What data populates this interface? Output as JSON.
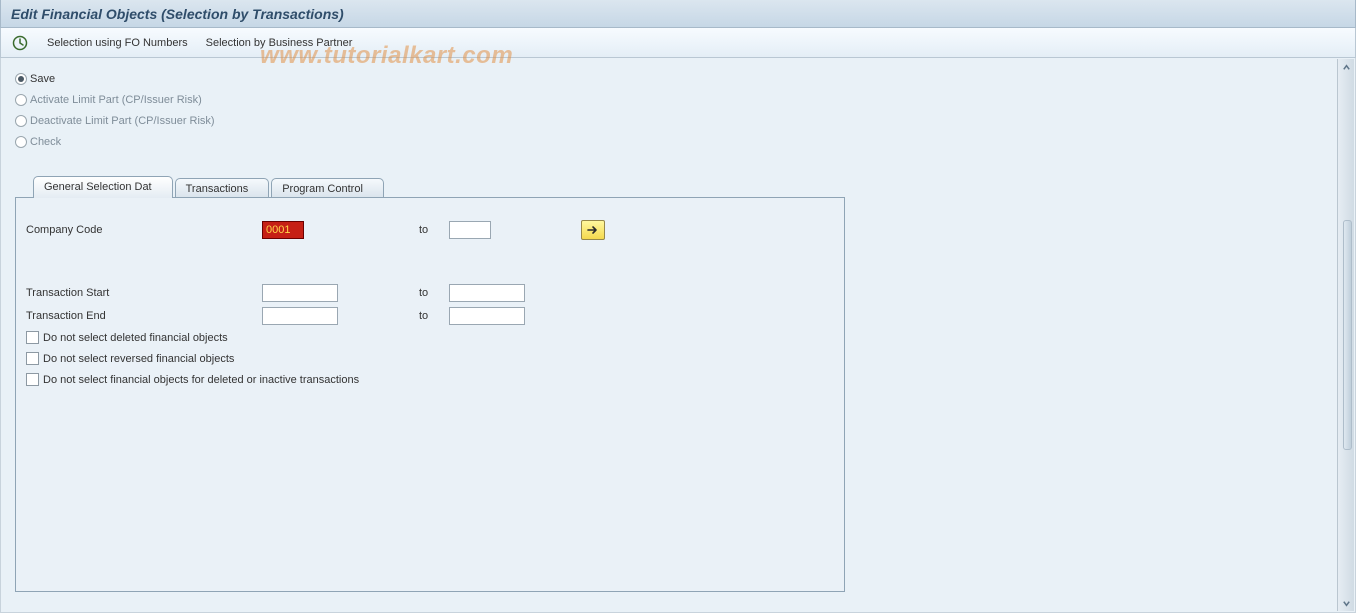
{
  "header": {
    "title": "Edit Financial Objects (Selection by Transactions)"
  },
  "toolbar": {
    "link1": "Selection using FO Numbers",
    "link2": "Selection by Business Partner"
  },
  "radios": {
    "save": "Save",
    "activate": "Activate Limit Part (CP/Issuer Risk)",
    "deactivate": "Deactivate Limit Part (CP/Issuer Risk)",
    "check": "Check"
  },
  "tabs": {
    "t1": "General Selection Dat",
    "t2": "Transactions",
    "t3": "Program Control"
  },
  "form": {
    "companyCodeLabel": "Company Code",
    "companyCodeValue": "0001",
    "toLabel": "to",
    "transStartLabel": "Transaction Start",
    "transEndLabel": "Transaction End",
    "chk1": "Do not select deleted financial objects",
    "chk2": "Do not select reversed financial objects",
    "chk3": "Do not select financial objects for deleted or inactive transactions"
  },
  "watermark": "www.tutorialkart.com"
}
